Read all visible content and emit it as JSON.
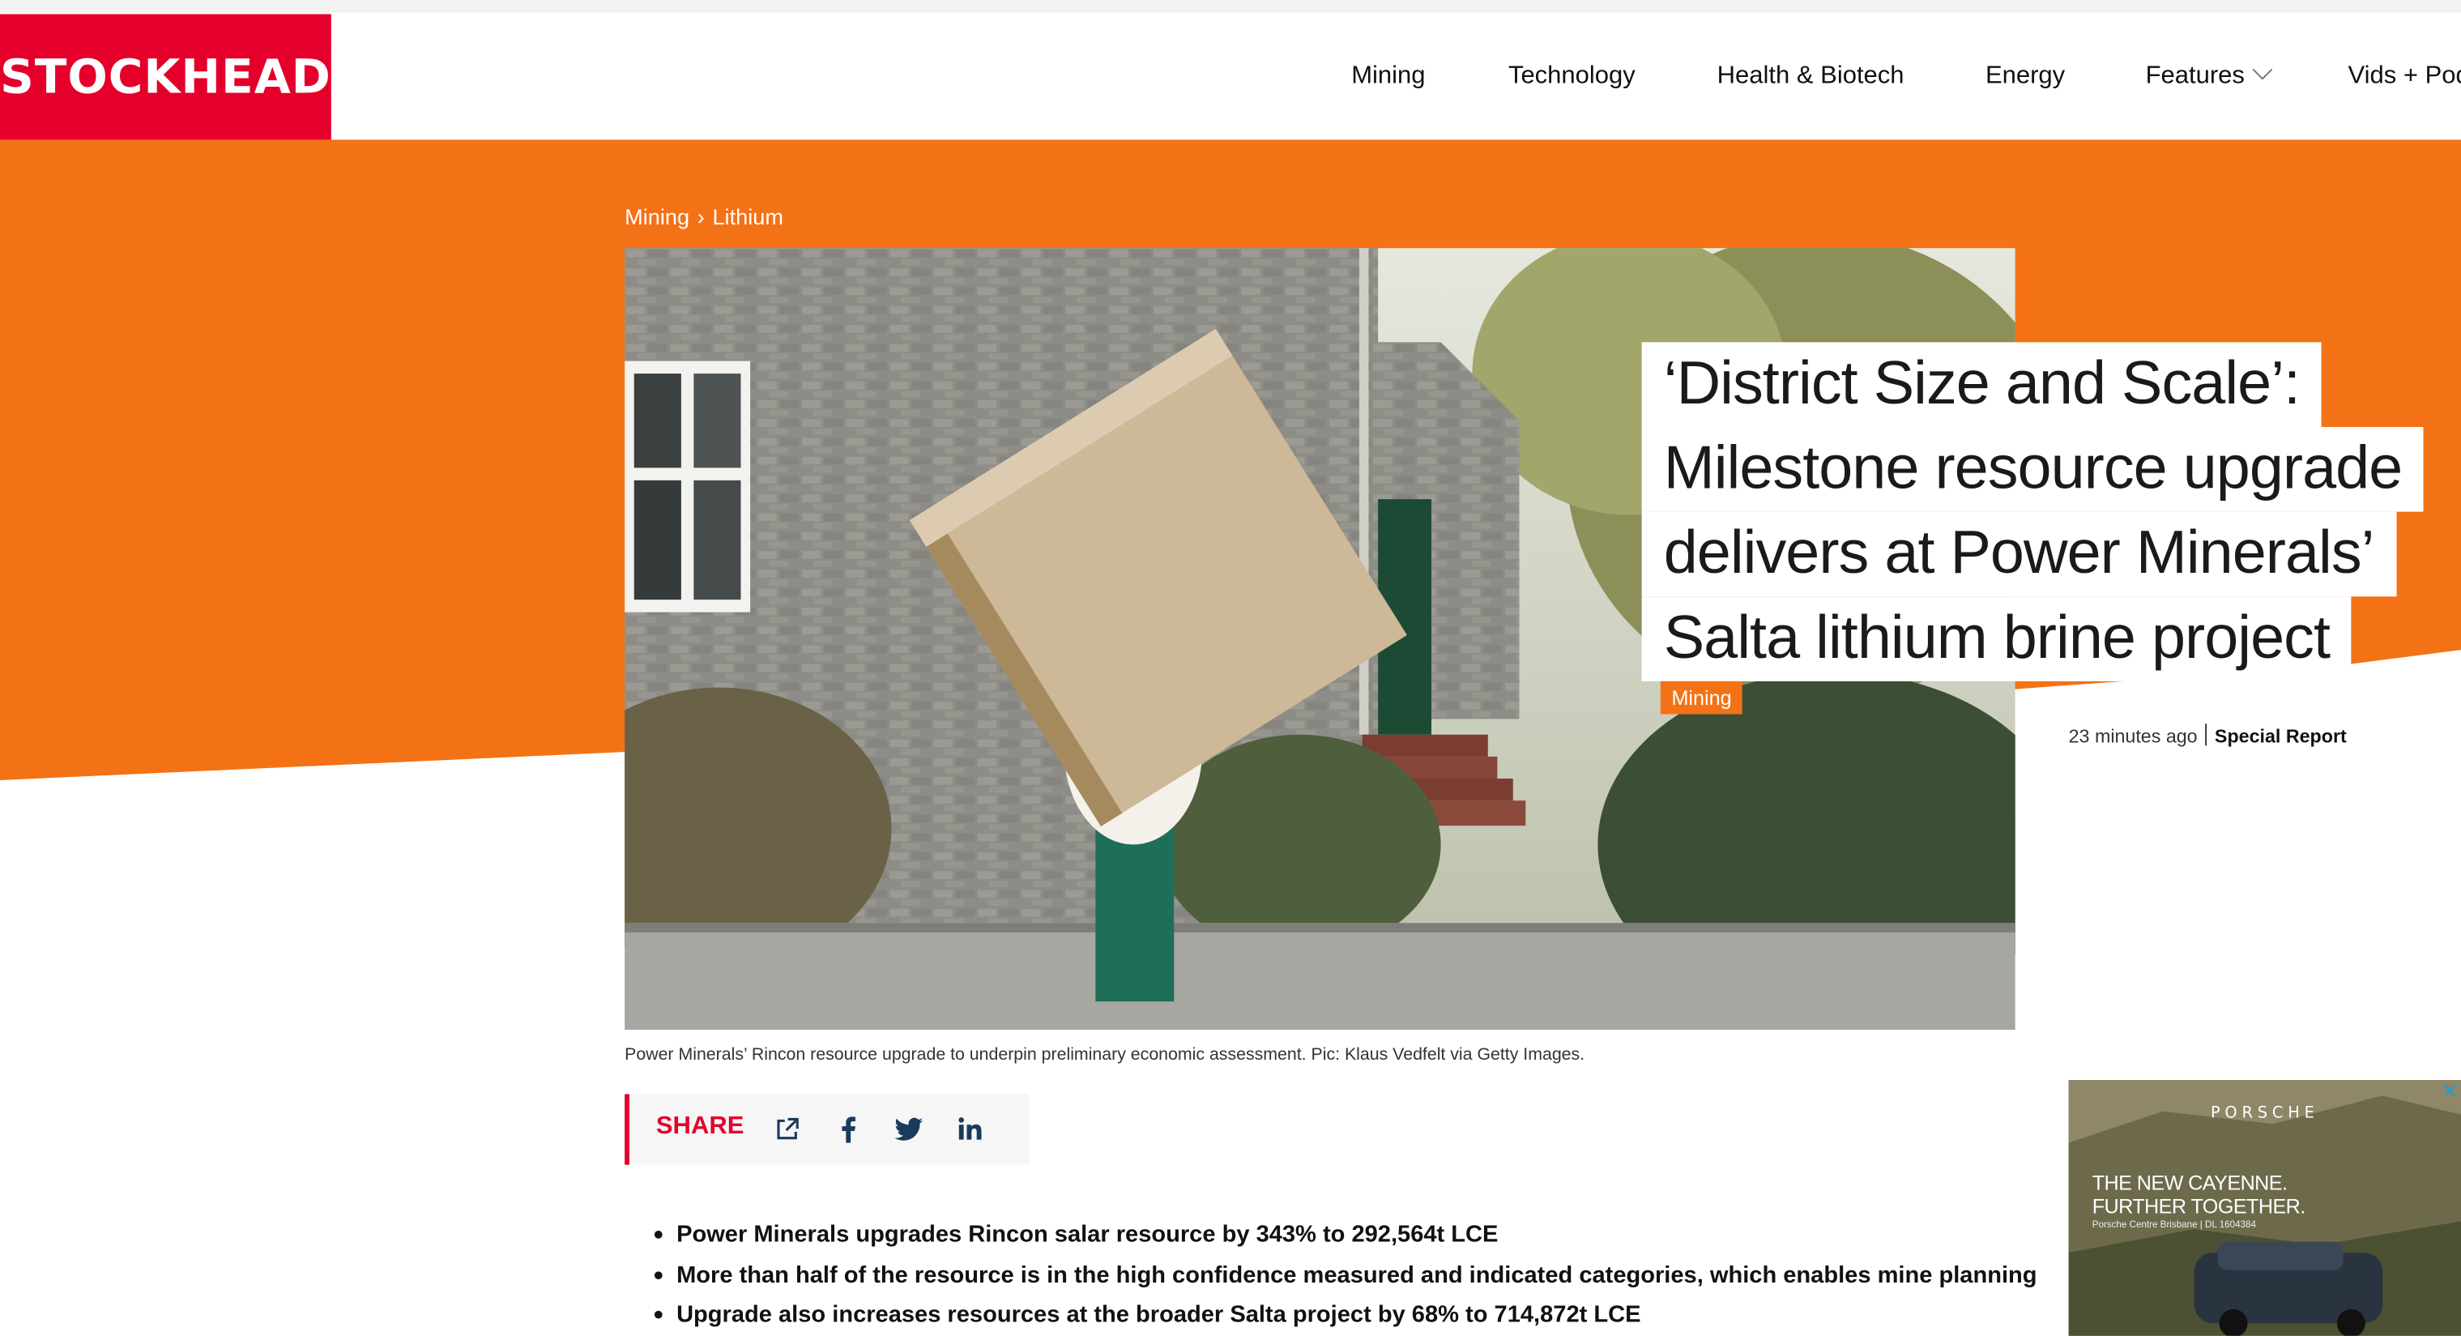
{
  "brand": {
    "logo": "STOCKHEAD"
  },
  "nav": {
    "items": [
      {
        "label": "Mining"
      },
      {
        "label": "Technology"
      },
      {
        "label": "Health & Biotech"
      },
      {
        "label": "Energy"
      },
      {
        "label": "Features"
      },
      {
        "label": "Vids + Pod"
      }
    ]
  },
  "breadcrumb": {
    "level1": "Mining",
    "separator": "›",
    "level2": "Lithium"
  },
  "article": {
    "headline_lines": [
      "‘District Size and Scale’:",
      "Milestone resource upgrade",
      "delivers at Power Minerals’",
      "Salta lithium brine project"
    ],
    "tag": "Mining",
    "time_ago": "23 minutes ago",
    "category": "Special Report",
    "caption": "Power Minerals’ Rincon resource upgrade to underpin preliminary economic assessment. Pic: Klaus Vedfelt via Getty Images.",
    "bullets": [
      "Power Minerals upgrades Rincon salar resource by 343% to 292,564t LCE",
      "More than half of the resource is in the high confidence measured and indicated categories, which enables mine planning",
      "Upgrade also increases resources at the broader Salta project by 68% to 714,872t LCE"
    ]
  },
  "share": {
    "label": "SHARE"
  },
  "ad": {
    "close": "✕",
    "brand": "PORSCHE",
    "headline_1": "THE NEW CAYENNE.",
    "headline_2": "FURTHER TOGETHER.",
    "fineprint": "Porsche Centre Brisbane | DL 1604384"
  },
  "colors": {
    "brand_red": "#e4002b",
    "accent_orange": "#f47216",
    "link_blue": "#1a9ed9"
  }
}
